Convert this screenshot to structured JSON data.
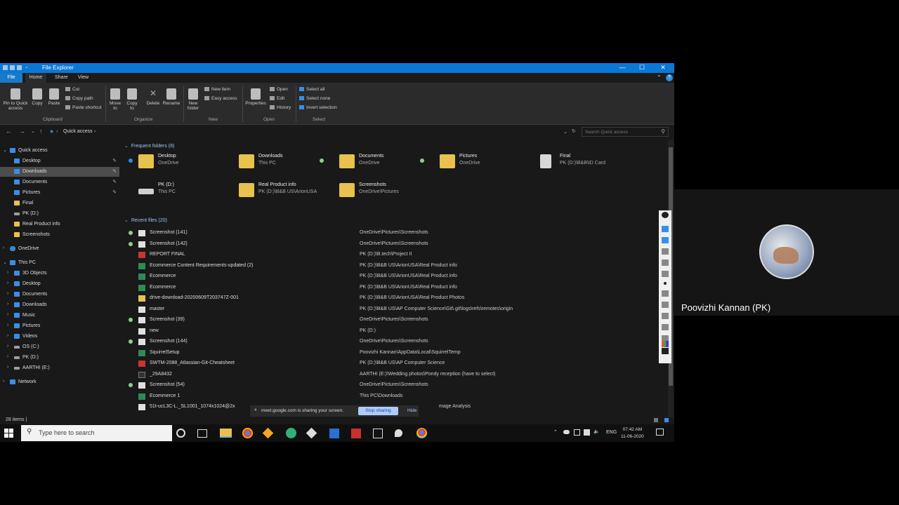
{
  "window": {
    "title": "File Explorer",
    "controls": [
      "—",
      "☐",
      "✕"
    ]
  },
  "ribbon_tabs": [
    "File",
    "Home",
    "Share",
    "View"
  ],
  "ribbon": {
    "clipboard": {
      "pin": "Pin to Quick access",
      "copy": "Copy",
      "paste": "Paste",
      "cut": "Cut",
      "copy_path": "Copy path",
      "paste_shortcut": "Paste shortcut",
      "label": "Clipboard"
    },
    "organize": {
      "move_to": "Move to",
      "copy_to": "Copy to",
      "delete": "Delete",
      "rename": "Rename",
      "label": "Organize"
    },
    "new": {
      "new_folder": "New folder",
      "new_item": "New item",
      "easy_access": "Easy access",
      "label": "New"
    },
    "open": {
      "properties": "Properties",
      "open": "Open",
      "edit": "Edit",
      "history": "History",
      "label": "Open"
    },
    "select": {
      "select_all": "Select all",
      "select_none": "Select none",
      "invert": "Invert selection",
      "label": "Select"
    }
  },
  "address": {
    "path": "Quick access",
    "search_placeholder": "Search Quick access"
  },
  "nav": [
    {
      "label": "Quick access",
      "kind": "pc",
      "indent": 0,
      "chev": "⌄"
    },
    {
      "label": "Desktop",
      "kind": "pc",
      "indent": 1,
      "pin": "📌"
    },
    {
      "label": "Downloads",
      "kind": "pc",
      "indent": 1,
      "pin": "📌",
      "selected": true
    },
    {
      "label": "Documents",
      "kind": "pc",
      "indent": 1,
      "pin": "📌"
    },
    {
      "label": "Pictures",
      "kind": "pc",
      "indent": 1,
      "pin": "📌"
    },
    {
      "label": "Final",
      "kind": "folder",
      "indent": 1
    },
    {
      "label": "PK (D:)",
      "kind": "drive",
      "indent": 1
    },
    {
      "label": "Real Product info",
      "kind": "folder",
      "indent": 1
    },
    {
      "label": "Screenshots",
      "kind": "folder",
      "indent": 1
    },
    {
      "label": "OneDrive",
      "kind": "cloud",
      "indent": 0,
      "chev": "›"
    },
    {
      "label": "This PC",
      "kind": "pc",
      "indent": 0,
      "chev": "⌄"
    },
    {
      "label": "3D Objects",
      "kind": "pc",
      "indent": 1,
      "chev": "›"
    },
    {
      "label": "Desktop",
      "kind": "pc",
      "indent": 1,
      "chev": "›"
    },
    {
      "label": "Documents",
      "kind": "pc",
      "indent": 1,
      "chev": "›"
    },
    {
      "label": "Downloads",
      "kind": "pc",
      "indent": 1,
      "chev": "›"
    },
    {
      "label": "Music",
      "kind": "pc",
      "indent": 1,
      "chev": "›"
    },
    {
      "label": "Pictures",
      "kind": "pc",
      "indent": 1,
      "chev": "›"
    },
    {
      "label": "Videos",
      "kind": "pc",
      "indent": 1,
      "chev": "›"
    },
    {
      "label": "OS (C:)",
      "kind": "drive",
      "indent": 1,
      "chev": "›"
    },
    {
      "label": "PK (D:)",
      "kind": "drive",
      "indent": 1,
      "chev": "›"
    },
    {
      "label": "AARTHI (E:)",
      "kind": "drive",
      "indent": 1,
      "chev": "›"
    },
    {
      "label": "Network",
      "kind": "pc",
      "indent": 0,
      "chev": "›"
    }
  ],
  "frequent": {
    "header": "Frequent folders (8)",
    "items": [
      {
        "name": "Desktop",
        "sub": "OneDrive",
        "status": "cloud",
        "icon": "folder"
      },
      {
        "name": "Downloads",
        "sub": "This PC",
        "status": "",
        "icon": "folder"
      },
      {
        "name": "Documents",
        "sub": "OneDrive",
        "status": "ok",
        "icon": "folder"
      },
      {
        "name": "Pictures",
        "sub": "OneDrive",
        "status": "ok",
        "icon": "folder"
      },
      {
        "name": "Final",
        "sub": "PK (D:)\\B&B\\ID Card",
        "status": "",
        "icon": "doc"
      },
      {
        "name": "PK (D:)",
        "sub": "This PC",
        "status": "",
        "icon": "drive"
      },
      {
        "name": "Real Product info",
        "sub": "PK (D:)\\B&B US\\ArionUSA",
        "status": "",
        "icon": "folder"
      },
      {
        "name": "Screenshots",
        "sub": "OneDrive\\Pictures",
        "status": "",
        "icon": "folder"
      }
    ]
  },
  "recent": {
    "header": "Recent files (20)",
    "items": [
      {
        "name": "Screenshot (141)",
        "path": "OneDrive\\Pictures\\Screenshots",
        "status": true,
        "icon": "img"
      },
      {
        "name": "Screenshot (142)",
        "path": "OneDrive\\Pictures\\Screenshots",
        "status": true,
        "icon": "img"
      },
      {
        "name": "REPORT FINAL",
        "path": "PK (D:)\\B.tech\\Project II",
        "status": false,
        "icon": "pdf"
      },
      {
        "name": "Ecommerce Content Requirements-updated (2)",
        "path": "PK (D:)\\B&B US\\ArionUSA\\Real Product info",
        "status": false,
        "icon": "xl"
      },
      {
        "name": "Ecommerce",
        "path": "PK (D:)\\B&B US\\ArionUSA\\Real Product info",
        "status": false,
        "icon": "xl"
      },
      {
        "name": "Ecommerce",
        "path": "PK (D:)\\B&B US\\ArionUSA\\Real Product info",
        "status": false,
        "icon": "xl"
      },
      {
        "name": "drive-download-20200609T203747Z-001",
        "path": "PK (D:)\\B&B US\\ArionUSA\\Real Product Photos",
        "status": false,
        "icon": "zip"
      },
      {
        "name": "master",
        "path": "PK (D:)\\B&B US\\AP Computer Science\\Git\\.git\\logs\\refs\\remotes\\origin",
        "status": false,
        "icon": "img"
      },
      {
        "name": "Screenshot (39)",
        "path": "OneDrive\\Pictures\\Screenshots",
        "status": true,
        "icon": "img"
      },
      {
        "name": "new",
        "path": "PK (D:)",
        "status": false,
        "icon": "img"
      },
      {
        "name": "Screenshot (144)",
        "path": "OneDrive\\Pictures\\Screenshots",
        "status": true,
        "icon": "img"
      },
      {
        "name": "SquirrelSetup",
        "path": "Poovizhi Kannan\\AppData\\Local\\SquirrelTemp",
        "status": false,
        "icon": "xl"
      },
      {
        "name": "SWTM-2088_Atlassian-Git-Cheatsheet",
        "path": "PK (D:)\\B&B US\\AP Computer Science",
        "status": false,
        "icon": "pdf"
      },
      {
        "name": "_29A8432",
        "path": "AARTHI (E:)\\Wedding photos\\Pondy reception (have to select)",
        "status": false,
        "icon": "dark"
      },
      {
        "name": "Screenshot (54)",
        "path": "OneDrive\\Pictures\\Screenshots",
        "status": true,
        "icon": "img"
      },
      {
        "name": "Ecommerce 1",
        "path": "This PC\\Downloads",
        "status": false,
        "icon": "xl"
      },
      {
        "name": "51t-ucL3C-L._SL1001_1074x1024@2x",
        "path": "mage Analysis",
        "status": false,
        "icon": "img"
      }
    ]
  },
  "statusbar": {
    "items": "28 items  |"
  },
  "sharing": {
    "text": "meet.google.com is sharing your screen.",
    "stop": "Stop sharing",
    "hide": "Hide"
  },
  "taskbar": {
    "search_placeholder": "Type here to search",
    "lang": "ENG",
    "time": "07:42 AM",
    "date": "11-06-2020"
  },
  "meet": {
    "participant": "Poovizhi Kannan (PK)"
  },
  "colors": {
    "accent": "#0a78d7",
    "folder": "#e8c14f",
    "status_ok": "#8fcf8f"
  }
}
